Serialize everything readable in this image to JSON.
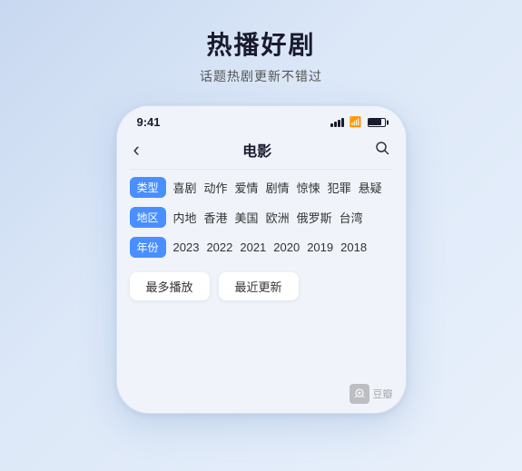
{
  "header": {
    "main_title": "热播好剧",
    "sub_title": "话题热剧更新不错过"
  },
  "phone": {
    "status_bar": {
      "time": "9:41"
    },
    "nav": {
      "back_icon": "‹",
      "title": "电影",
      "search_icon": "○"
    },
    "filters": [
      {
        "label": "类型",
        "items": [
          "喜剧",
          "动作",
          "爱情",
          "剧情",
          "惊悚",
          "犯罪",
          "悬疑"
        ]
      },
      {
        "label": "地区",
        "items": [
          "内地",
          "香港",
          "美国",
          "欧洲",
          "俄罗斯",
          "台湾"
        ]
      },
      {
        "label": "年份",
        "items": [
          "2023",
          "2022",
          "2021",
          "2020",
          "2019",
          "2018"
        ]
      }
    ],
    "buttons": [
      "最多播放",
      "最近更新"
    ]
  }
}
